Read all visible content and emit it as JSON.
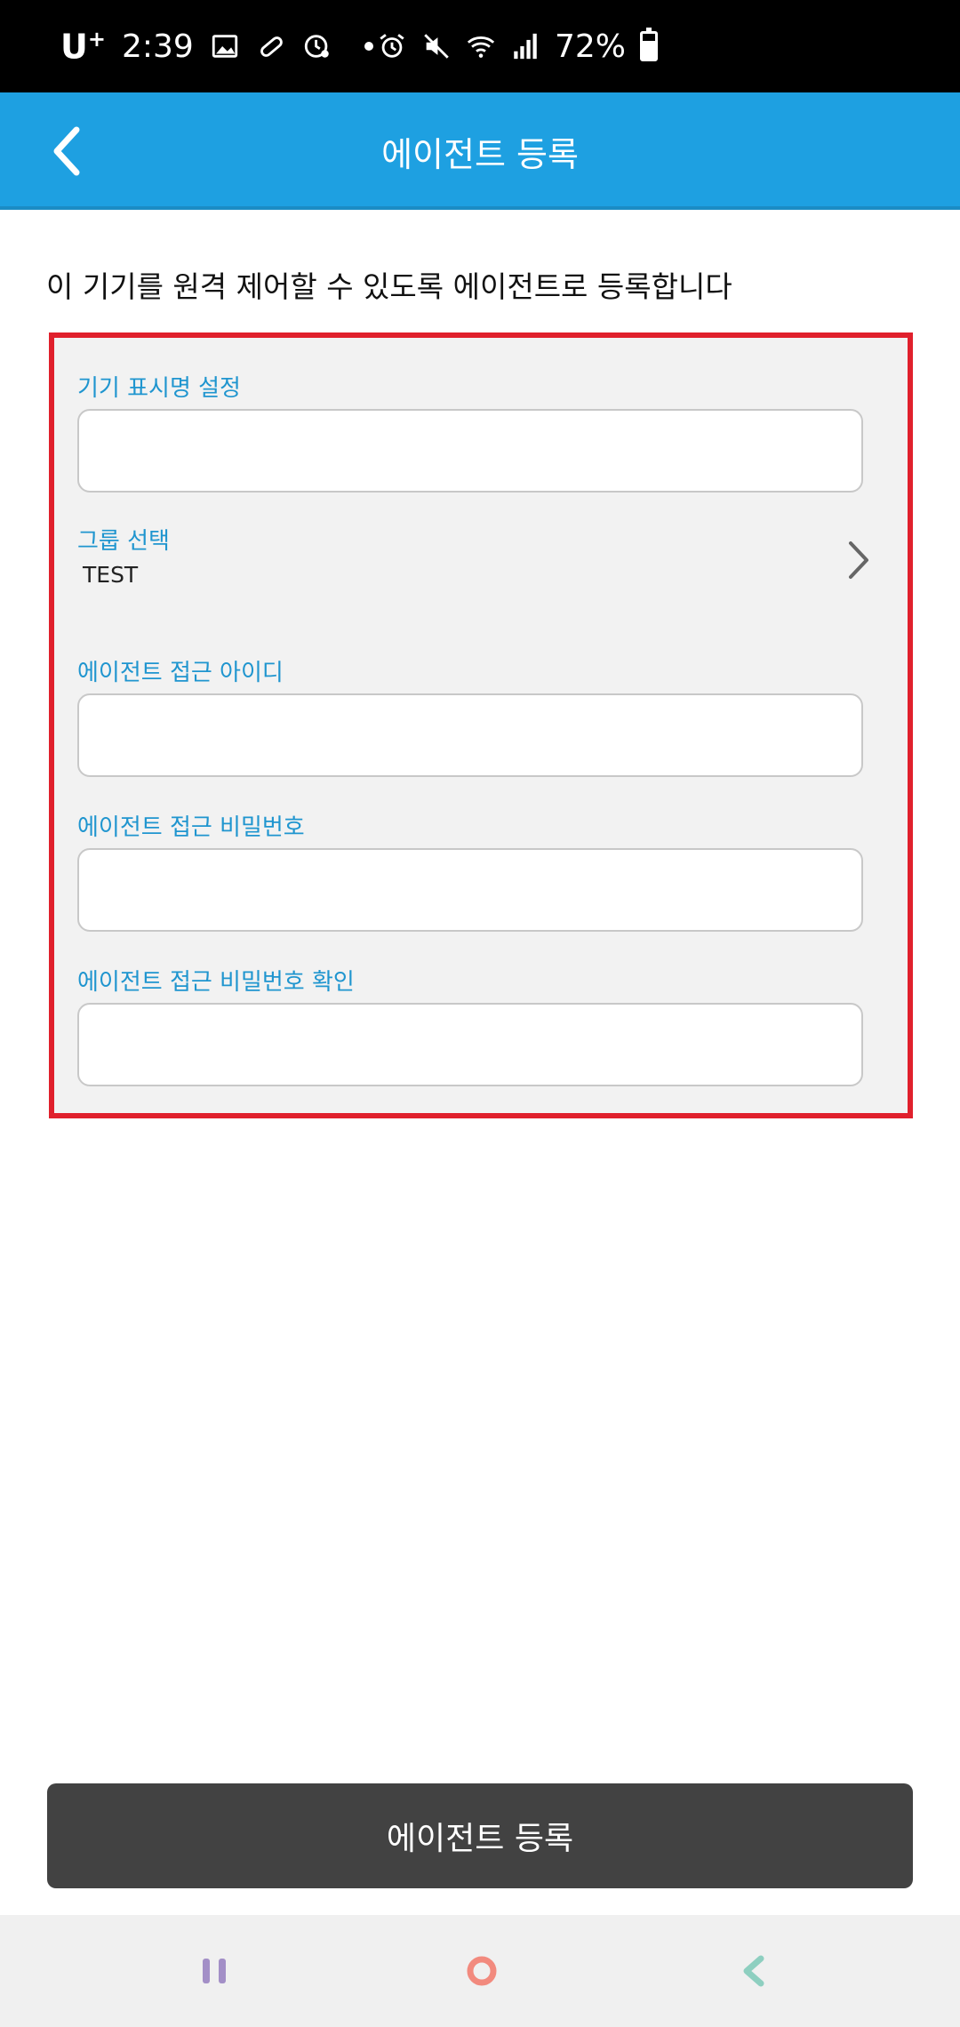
{
  "status_bar": {
    "carrier": "U",
    "carrier_sup": "+",
    "time": "2:39",
    "battery": "72%"
  },
  "app_bar": {
    "title": "에이전트 등록",
    "back_icon": "chevron-left-icon"
  },
  "description": "이 기기를 원격 제어할 수 있도록 에이전트로 등록합니다",
  "form": {
    "device_name": {
      "label": "기기 표시명 설정",
      "value": ""
    },
    "group": {
      "label": "그룹 선택",
      "value": "TEST"
    },
    "agent_id": {
      "label": "에이전트 접근 아이디",
      "value": ""
    },
    "agent_password": {
      "label": "에이전트 접근 비밀번호",
      "value": ""
    },
    "agent_password_confirm": {
      "label": "에이전트 접근 비밀번호 확인",
      "value": ""
    }
  },
  "register_button": "에이전트 등록",
  "colors": {
    "accent": "#1ea0e1",
    "label": "#1f95cf",
    "highlight_border": "#e0202c",
    "button": "#424242"
  }
}
